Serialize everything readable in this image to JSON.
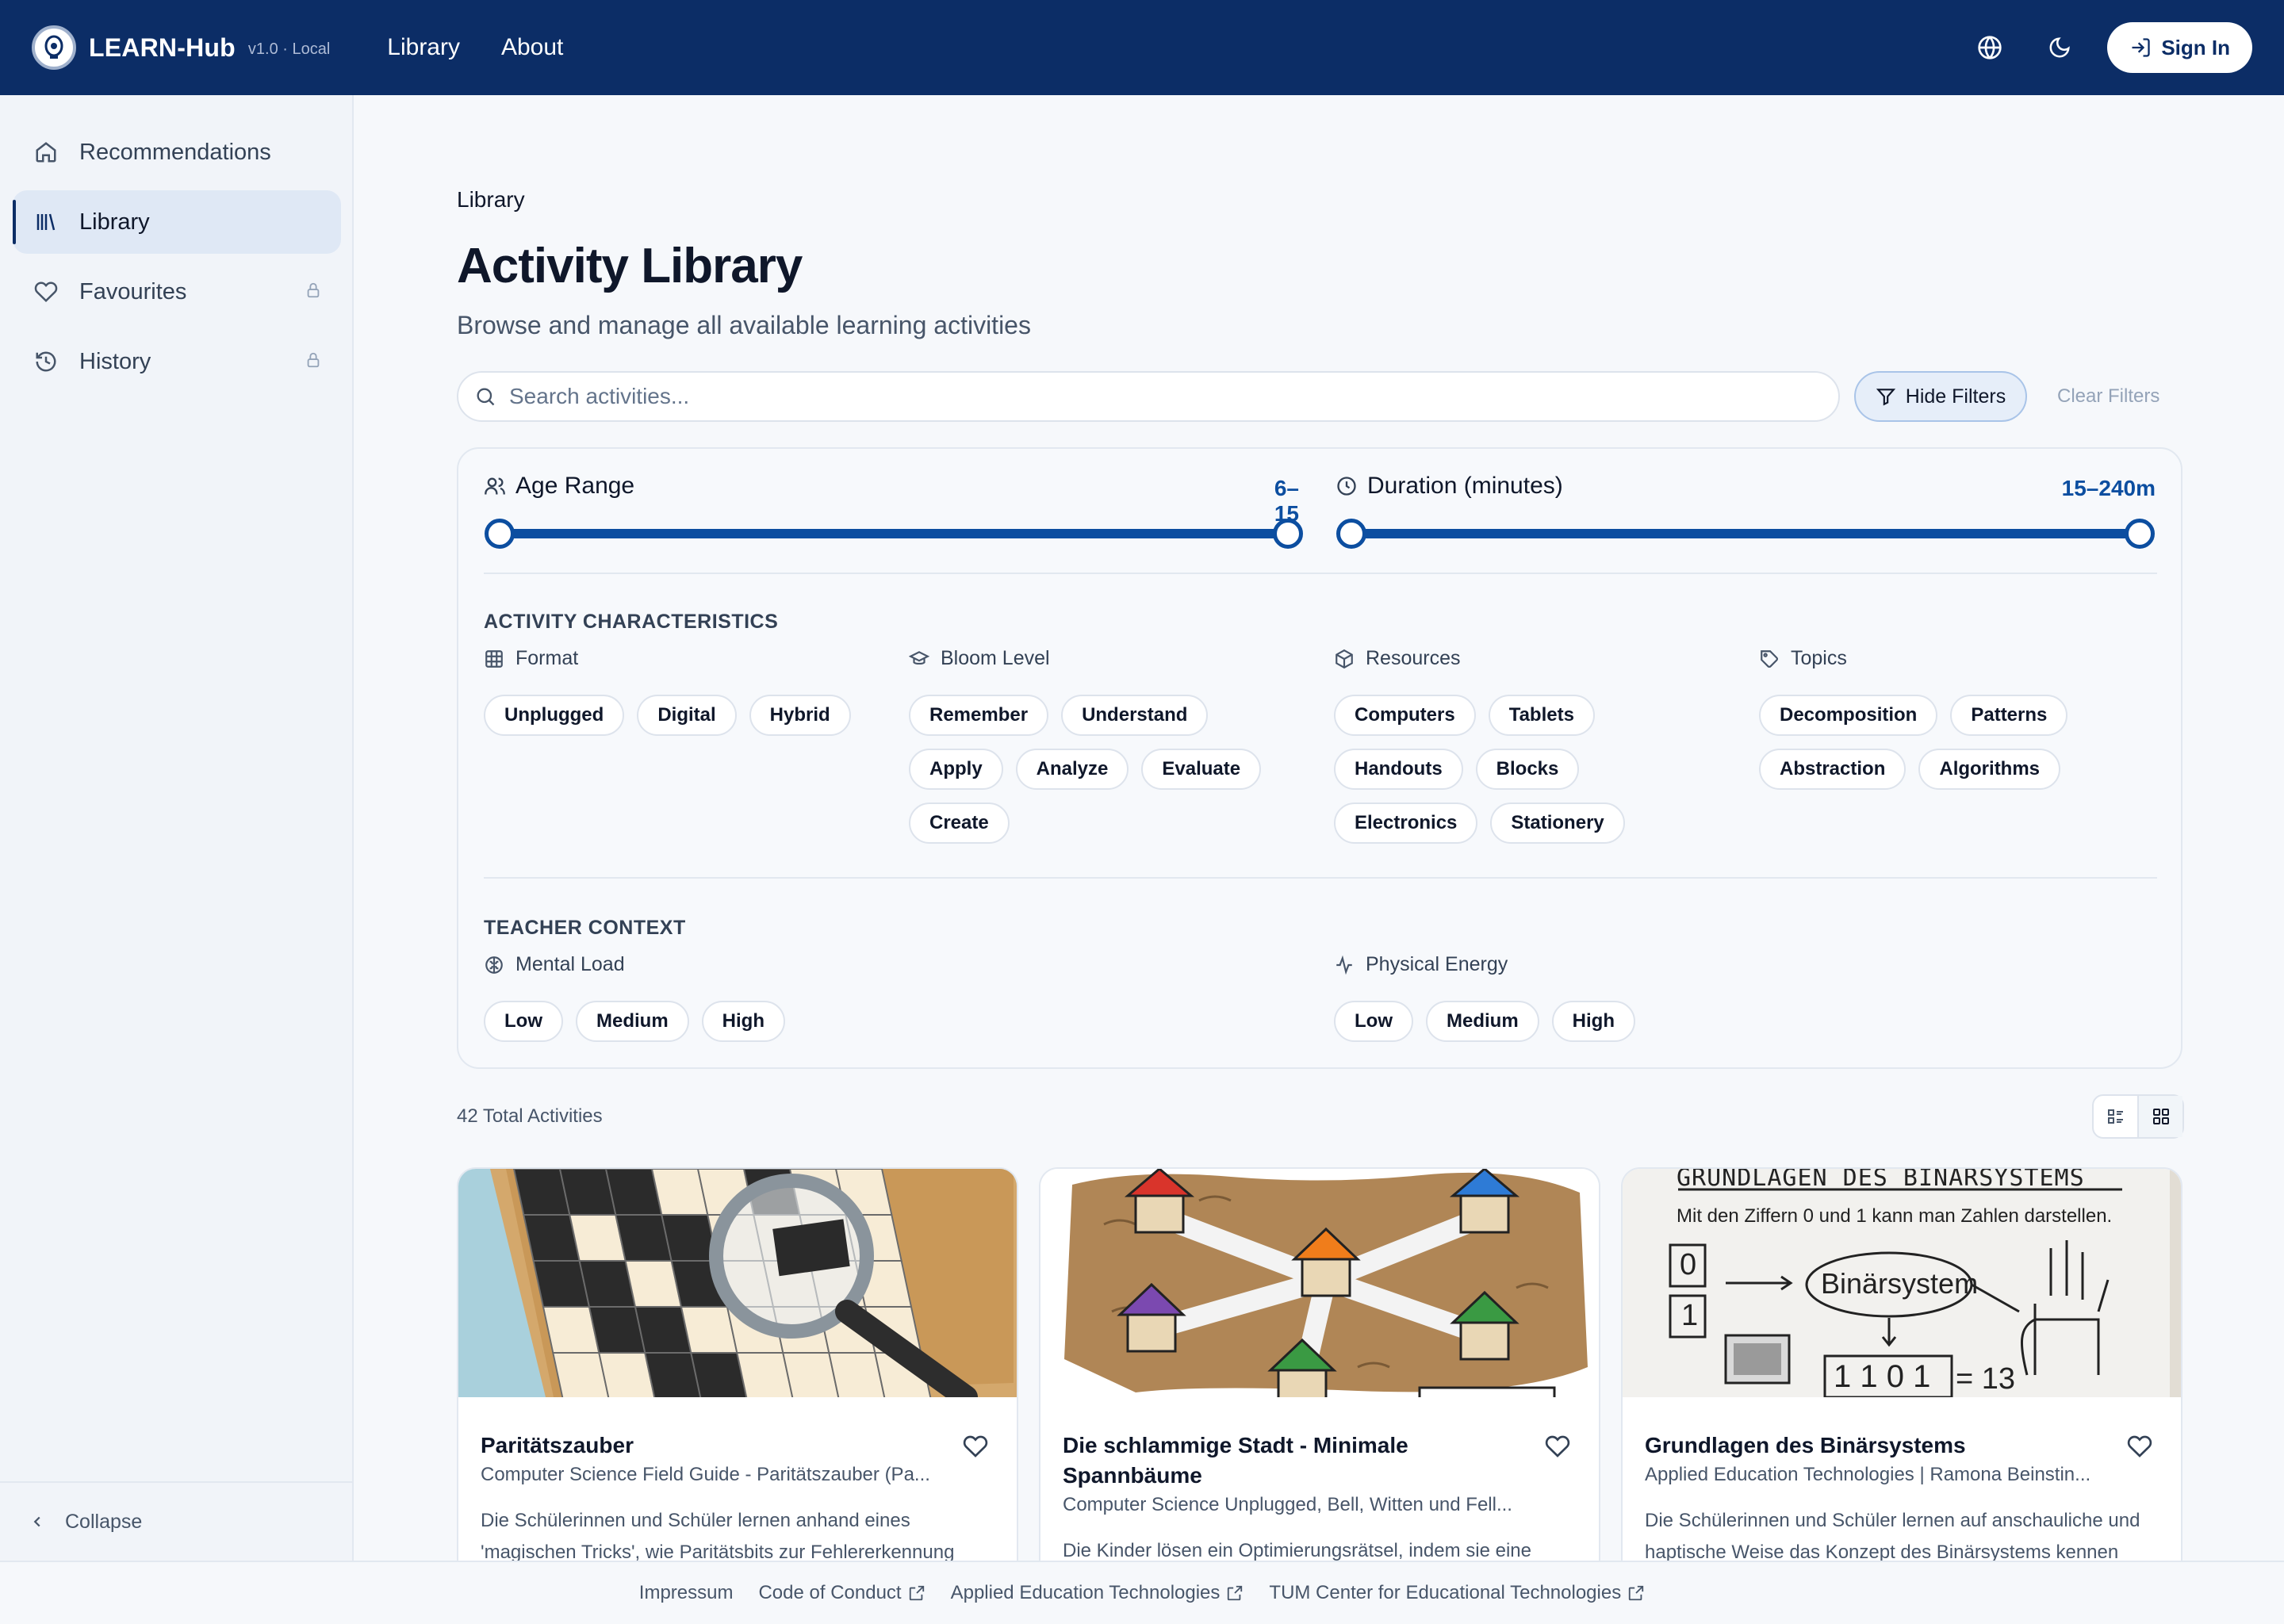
{
  "app": {
    "name": "LEARN-Hub",
    "version": "v1.0 · Local"
  },
  "topnav": [
    {
      "label": "Library"
    },
    {
      "label": "About"
    }
  ],
  "header": {
    "signin_label": "Sign In"
  },
  "sidebar": {
    "items": [
      {
        "label": "Recommendations",
        "icon": "home-icon"
      },
      {
        "label": "Library",
        "icon": "library-icon",
        "active": true
      },
      {
        "label": "Favourites",
        "icon": "heart-icon",
        "locked": true
      },
      {
        "label": "History",
        "icon": "history-icon",
        "locked": true
      }
    ],
    "collapse_label": "Collapse"
  },
  "page": {
    "breadcrumb": "Library",
    "title": "Activity Library",
    "subtitle": "Browse and manage all available learning activities"
  },
  "search": {
    "placeholder": "Search activities...",
    "value": ""
  },
  "filters": {
    "hide_label": "Hide Filters",
    "clear_label": "Clear Filters",
    "age": {
      "label": "Age Range",
      "display": "6–15",
      "range": [
        6,
        15
      ]
    },
    "duration": {
      "label": "Duration (minutes)",
      "display": "15–240m",
      "range": [
        15,
        240
      ]
    },
    "characteristics": {
      "title": "ACTIVITY CHARACTERISTICS",
      "format": {
        "label": "Format",
        "options": [
          "Unplugged",
          "Digital",
          "Hybrid"
        ]
      },
      "bloom": {
        "label": "Bloom Level",
        "options": [
          "Remember",
          "Understand",
          "Apply",
          "Analyze",
          "Evaluate",
          "Create"
        ]
      },
      "resources": {
        "label": "Resources",
        "options": [
          "Computers",
          "Tablets",
          "Handouts",
          "Blocks",
          "Electronics",
          "Stationery"
        ]
      },
      "topics": {
        "label": "Topics",
        "options": [
          "Decomposition",
          "Patterns",
          "Abstraction",
          "Algorithms"
        ]
      }
    },
    "teacher": {
      "title": "TEACHER CONTEXT",
      "mental": {
        "label": "Mental Load",
        "options": [
          "Low",
          "Medium",
          "High"
        ]
      },
      "physical": {
        "label": "Physical Energy",
        "options": [
          "Low",
          "Medium",
          "High"
        ]
      }
    }
  },
  "results": {
    "total_label": "42 Total Activities"
  },
  "cards": [
    {
      "title": "Paritätszauber",
      "source": "Computer Science Field Guide - Paritätszauber (Pa...",
      "description": "Die Schülerinnen und Schüler lernen anhand eines 'magischen Tricks', wie Paritätsbits zur Fehlererkennung"
    },
    {
      "title": "Die schlammige Stadt - Minimale Spannbäume",
      "source": "Computer Science Unplugged, Bell, Witten und Fell...",
      "description": "Die Kinder lösen ein Optimierungsrätsel, indem sie eine"
    },
    {
      "title": "Grundlagen des Binärsystems",
      "source": "Applied Education Technologies | Ramona Beinstin...",
      "description": "Die Schülerinnen und Schüler lernen auf anschauliche und haptische Weise das Konzept des Binärsystems kennen",
      "thumb_text": {
        "heading": "GRUNDLAGEN DES BINÄRSYSTEMS",
        "line": "Mit den Ziffern 0 und 1 kann man Zahlen darstellen.",
        "bubble": "Binärsystem",
        "digit0": "0",
        "digit1": "1",
        "equation": "1 1 0 1",
        "result": "= 13"
      }
    }
  ],
  "footer": [
    {
      "label": "Impressum",
      "external": false
    },
    {
      "label": "Code of Conduct",
      "external": true
    },
    {
      "label": "Applied Education Technologies",
      "external": true
    },
    {
      "label": "TUM Center for Educational Technologies",
      "external": true
    }
  ],
  "colors": {
    "primary": "#0c2d66",
    "accent": "#0c4ea0"
  }
}
